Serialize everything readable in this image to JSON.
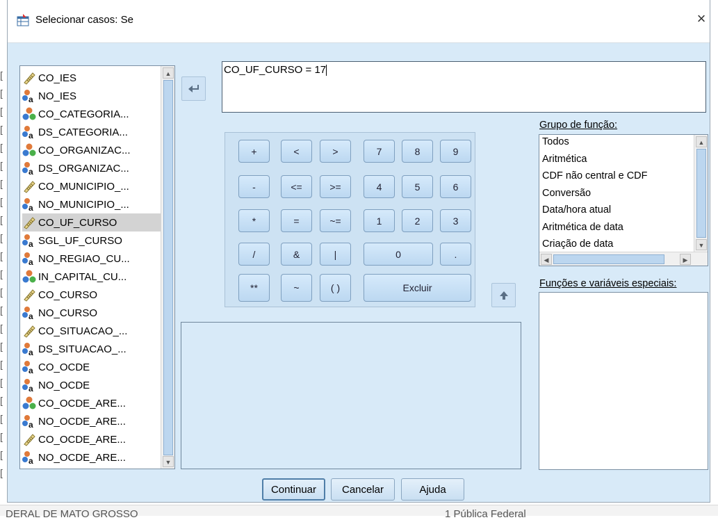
{
  "window": {
    "title": "Selecionar casos: Se",
    "close_glyph": "×"
  },
  "variables": [
    {
      "name": "CO_IES",
      "icon": "scale-icon"
    },
    {
      "name": "NO_IES",
      "icon": "nominal-string-icon"
    },
    {
      "name": "CO_CATEGORIA...",
      "icon": "nominal-icon"
    },
    {
      "name": "DS_CATEGORIA...",
      "icon": "nominal-string-icon"
    },
    {
      "name": "CO_ORGANIZAC...",
      "icon": "nominal-icon"
    },
    {
      "name": "DS_ORGANIZAC...",
      "icon": "nominal-string-icon"
    },
    {
      "name": "CO_MUNICIPIO_...",
      "icon": "scale-icon"
    },
    {
      "name": "NO_MUNICIPIO_...",
      "icon": "nominal-string-icon"
    },
    {
      "name": "CO_UF_CURSO",
      "icon": "scale-icon",
      "selected": true
    },
    {
      "name": "SGL_UF_CURSO",
      "icon": "nominal-string-icon"
    },
    {
      "name": "NO_REGIAO_CU...",
      "icon": "nominal-string-icon"
    },
    {
      "name": "IN_CAPITAL_CU...",
      "icon": "nominal-icon"
    },
    {
      "name": "CO_CURSO",
      "icon": "scale-icon"
    },
    {
      "name": "NO_CURSO",
      "icon": "nominal-string-icon"
    },
    {
      "name": "CO_SITUACAO_...",
      "icon": "scale-icon"
    },
    {
      "name": "DS_SITUACAO_...",
      "icon": "nominal-string-icon"
    },
    {
      "name": "CO_OCDE",
      "icon": "nominal-string-icon"
    },
    {
      "name": "NO_OCDE",
      "icon": "nominal-string-icon"
    },
    {
      "name": "CO_OCDE_ARE...",
      "icon": "nominal-icon"
    },
    {
      "name": "NO_OCDE_ARE...",
      "icon": "nominal-string-icon"
    },
    {
      "name": "CO_OCDE_ARE...",
      "icon": "scale-icon"
    },
    {
      "name": "NO_OCDE_ARE...",
      "icon": "nominal-string-icon"
    },
    {
      "name": "CO_OCDE_ARE...",
      "icon": "scale-icon"
    }
  ],
  "expression": "CO_UF_CURSO = 17",
  "keypad": {
    "plus": "+",
    "lt": "<",
    "gt": ">",
    "seven": "7",
    "eight": "8",
    "nine": "9",
    "minus": "-",
    "le": "<=",
    "ge": ">=",
    "four": "4",
    "five": "5",
    "six": "6",
    "mult": "*",
    "eq": "=",
    "ne": "~=",
    "one": "1",
    "two": "2",
    "three": "3",
    "div": "/",
    "amp": "&",
    "pipe": "|",
    "zero": "0",
    "dot": ".",
    "pow": "**",
    "tilde": "~",
    "parens": "( )",
    "delete": "Excluir"
  },
  "function_group": {
    "label": "Grupo de função:",
    "items": [
      "Todos",
      "Aritmética",
      "CDF não central e CDF",
      "Conversão",
      "Data/hora atual",
      "Aritmética de data",
      "Criação de data"
    ]
  },
  "special_functions": {
    "label": "Funções e variáveis especiais:"
  },
  "buttons": {
    "continue": "Continuar",
    "cancel": "Cancelar",
    "help": "Ajuda"
  },
  "background": {
    "bottom_left": "DERAL DE MATO GROSSO",
    "bottom_right": "1 Pública Federal"
  },
  "colors": {
    "dialog_bg": "#d8eaf8",
    "key_bg": "#c8e0f5",
    "selection": "#d3d3d3"
  }
}
